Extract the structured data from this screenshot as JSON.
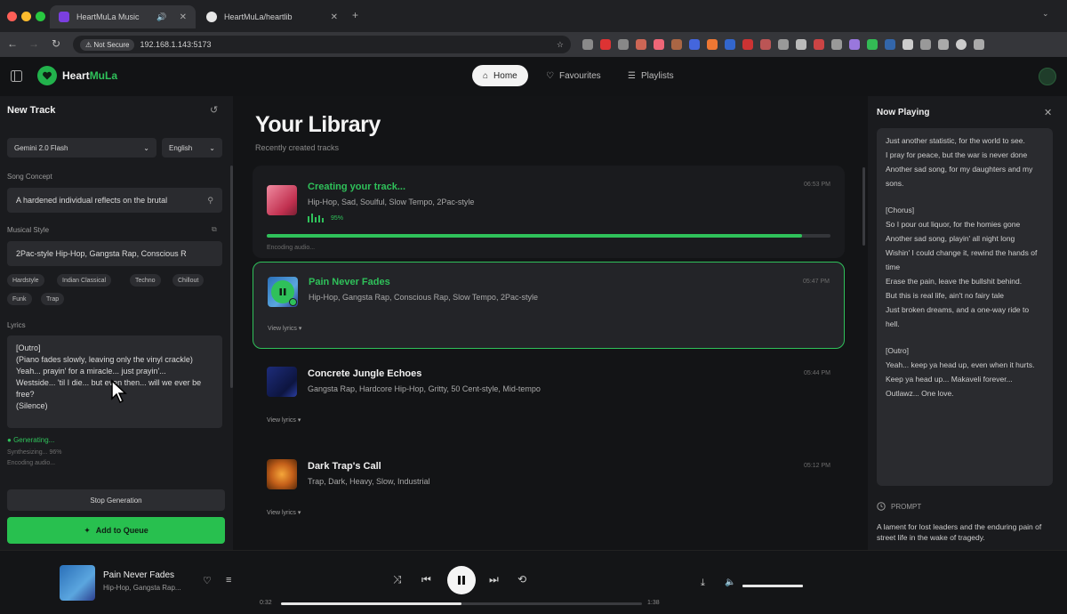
{
  "browser": {
    "tabs": [
      {
        "title": "HeartMuLa Music",
        "active": true
      },
      {
        "title": "HeartMuLa/heartlib",
        "active": false
      }
    ],
    "not_secure_label": "Not Secure",
    "url": "192.168.1.143:5173"
  },
  "header": {
    "brand_prefix": "Heart",
    "brand_suffix": "MuLa",
    "nav": [
      {
        "label": "Home",
        "active": true
      },
      {
        "label": "Favourites",
        "active": false
      },
      {
        "label": "Playlists",
        "active": false
      }
    ]
  },
  "left_panel": {
    "title": "New Track",
    "model": "Gemini 2.0 Flash",
    "language": "English",
    "concept_label": "Song Concept",
    "concept_value": "A hardened individual reflects on the brutal",
    "style_label": "Musical Style",
    "style_value": "2Pac-style Hip-Hop, Gangsta Rap, Conscious R",
    "chips": [
      "Hardstyle",
      "Indian Classical",
      "Techno",
      "Chillout",
      "Funk",
      "Trap"
    ],
    "lyrics_label": "Lyrics",
    "lyrics_text": "[Outro]\n(Piano fades slowly, leaving only the vinyl crackle)\nYeah... prayin' for a miracle... just prayin'...\nWestside... 'til I die... but even then... will we ever be free?\n(Silence)",
    "status_generating": "Generating...",
    "status_sub1": "Synthesizing... 96%",
    "status_sub2": "Encoding audio...",
    "stop_label": "Stop Generation",
    "queue_label": "Add to Queue"
  },
  "library": {
    "title": "Your Library",
    "subtitle": "Recently created tracks",
    "tracks": [
      {
        "title": "Creating your track...",
        "tags": "Hip-Hop, Sad, Soulful, Slow Tempo, 2Pac-style",
        "time": "06:53 PM",
        "percent": "95%",
        "progress": 0.95,
        "status": "Encoding audio..."
      },
      {
        "title": "Pain Never Fades",
        "tags": "Hip-Hop, Gangsta Rap, Conscious Rap, Slow Tempo, 2Pac-style",
        "time": "05:47 PM",
        "view_lyrics": "View lyrics ▾"
      },
      {
        "title": "Concrete Jungle Echoes",
        "tags": "Gangsta Rap, Hardcore Hip-Hop, Gritty, 50 Cent-style, Mid-tempo",
        "time": "05:44 PM",
        "view_lyrics": "View lyrics ▾"
      },
      {
        "title": "Dark Trap's Call",
        "tags": "Trap, Dark, Heavy, Slow, Industrial",
        "time": "05:12 PM",
        "view_lyrics": "View lyrics ▾"
      }
    ]
  },
  "now_playing": {
    "title": "Now Playing",
    "lyrics": [
      "Just another statistic, for the world to see.",
      "I pray for peace, but the war is never done",
      "Another sad song, for my daughters and my sons.",
      "",
      "[Chorus]",
      "So I pour out liquor, for the homies gone",
      "Another sad song, playin' all night long",
      "Wishin' I could change it, rewind the hands of time",
      "Erase the pain, leave the bullshit behind.",
      "But this is real life, ain't no fairy tale",
      "Just broken dreams, and a one-way ride to hell.",
      "",
      "[Outro]",
      "Yeah... keep ya head up, even when it hurts. Keep ya head up... Makaveli forever... Outlawz... One love."
    ],
    "prompt_label": "PROMPT",
    "prompt_text": "A lament for lost leaders and the enduring pain of street life in the wake of tragedy."
  },
  "player": {
    "title": "Pain Never Fades",
    "subtitle": "Hip-Hop, Gangsta Rap...",
    "time_current": "0:32",
    "time_total": "1:38",
    "progress": 0.5,
    "volume": 1.0
  },
  "colors": {
    "accent": "#2fc15a",
    "background": "#121315",
    "panel": "#1a1b1e"
  }
}
